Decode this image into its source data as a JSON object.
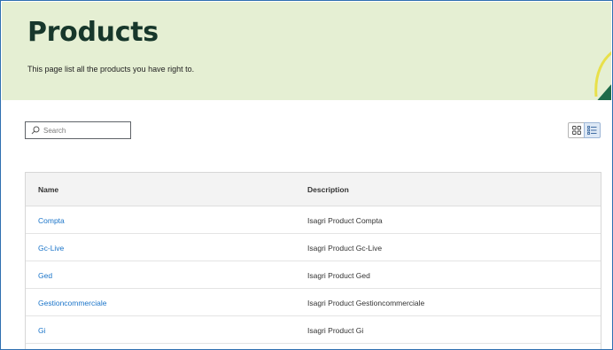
{
  "header": {
    "title": "Products",
    "subtitle": "This page list all the products you have right to."
  },
  "search": {
    "placeholder": "Search",
    "value": ""
  },
  "view_toggle": {
    "options": [
      "grid",
      "list"
    ],
    "active": "list"
  },
  "table": {
    "columns": [
      "Name",
      "Description"
    ],
    "rows": [
      {
        "name": "Compta",
        "description": "Isagri Product Compta"
      },
      {
        "name": "Gc-Live",
        "description": "Isagri Product Gc-Live"
      },
      {
        "name": "Ged",
        "description": "Isagri Product Ged"
      },
      {
        "name": "Gestioncommerciale",
        "description": "Isagri Product Gestioncommerciale"
      },
      {
        "name": "Gi",
        "description": "Isagri Product Gi"
      }
    ]
  },
  "colors": {
    "banner_bg": "#e5efd3",
    "title": "#17372b",
    "link": "#1a74c9",
    "accent_green": "#1e6b4a",
    "accent_yellow": "#e8e04a"
  }
}
